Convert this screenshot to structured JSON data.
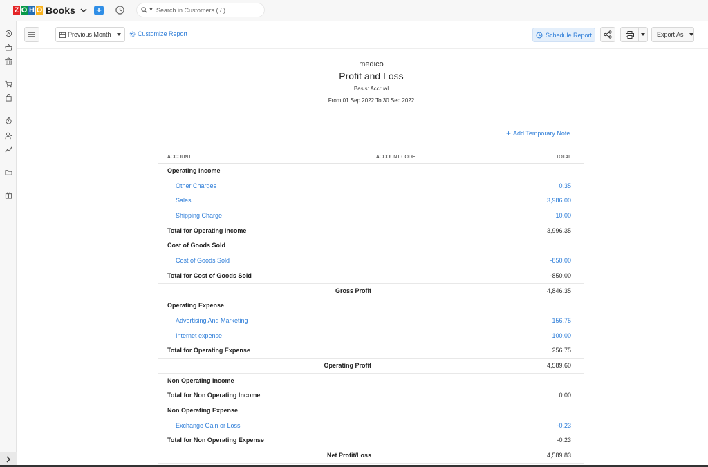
{
  "app": {
    "logo_letters": [
      "Z",
      "O",
      "H",
      "O"
    ],
    "logo_colors": [
      "#e42527",
      "#089949",
      "#226db4",
      "#f9b21d"
    ],
    "name": "Books"
  },
  "search": {
    "placeholder": "Search in Customers ( / )"
  },
  "sidebar": {
    "icons": [
      "home-icon",
      "basket-icon",
      "bank-icon",
      "cart-icon",
      "bag-icon",
      "timer-icon",
      "user-icon",
      "chart-icon",
      "folder-icon",
      "box-icon"
    ]
  },
  "toolbar": {
    "period": "Previous Month",
    "customize_label": "Customize Report",
    "schedule_label": "Schedule Report",
    "export_label": "Export As"
  },
  "report": {
    "org": "medico",
    "title": "Profit and Loss",
    "basis": "Basis: Accrual",
    "range": "From 01 Sep 2022 To 30 Sep 2022",
    "add_note": "Add Temporary Note",
    "columns": {
      "account": "ACCOUNT",
      "code": "ACCOUNT CODE",
      "total": "TOTAL"
    },
    "rows": [
      {
        "type": "group",
        "label": "Operating Income"
      },
      {
        "type": "item",
        "label": "Other Charges",
        "value": "0.35"
      },
      {
        "type": "item",
        "label": "Sales",
        "value": "3,986.00"
      },
      {
        "type": "item",
        "label": "Shipping Charge",
        "value": "10.00"
      },
      {
        "type": "total",
        "label": "Total for Operating Income",
        "value": "3,996.35"
      },
      {
        "type": "group",
        "label": "Cost of Goods Sold"
      },
      {
        "type": "item",
        "label": "Cost of Goods Sold",
        "value": "-850.00"
      },
      {
        "type": "total",
        "label": "Total for Cost of Goods Sold",
        "value": "-850.00"
      },
      {
        "type": "calc",
        "label": "Gross Profit",
        "value": "4,846.35"
      },
      {
        "type": "group",
        "label": "Operating Expense"
      },
      {
        "type": "item",
        "label": "Advertising And Marketing",
        "value": "156.75"
      },
      {
        "type": "item",
        "label": "Internet expense",
        "value": "100.00"
      },
      {
        "type": "total",
        "label": "Total for Operating Expense",
        "value": "256.75"
      },
      {
        "type": "calc",
        "label": "Operating Profit",
        "value": "4,589.60"
      },
      {
        "type": "group",
        "label": "Non Operating Income"
      },
      {
        "type": "total",
        "label": "Total for Non Operating Income",
        "value": "0.00"
      },
      {
        "type": "group",
        "label": "Non Operating Expense"
      },
      {
        "type": "item",
        "label": "Exchange Gain or Loss",
        "value": "-0.23"
      },
      {
        "type": "total",
        "label": "Total for Non Operating Expense",
        "value": "-0.23"
      },
      {
        "type": "calc",
        "label": "Net Profit/Loss",
        "value": "4,589.83"
      }
    ]
  }
}
